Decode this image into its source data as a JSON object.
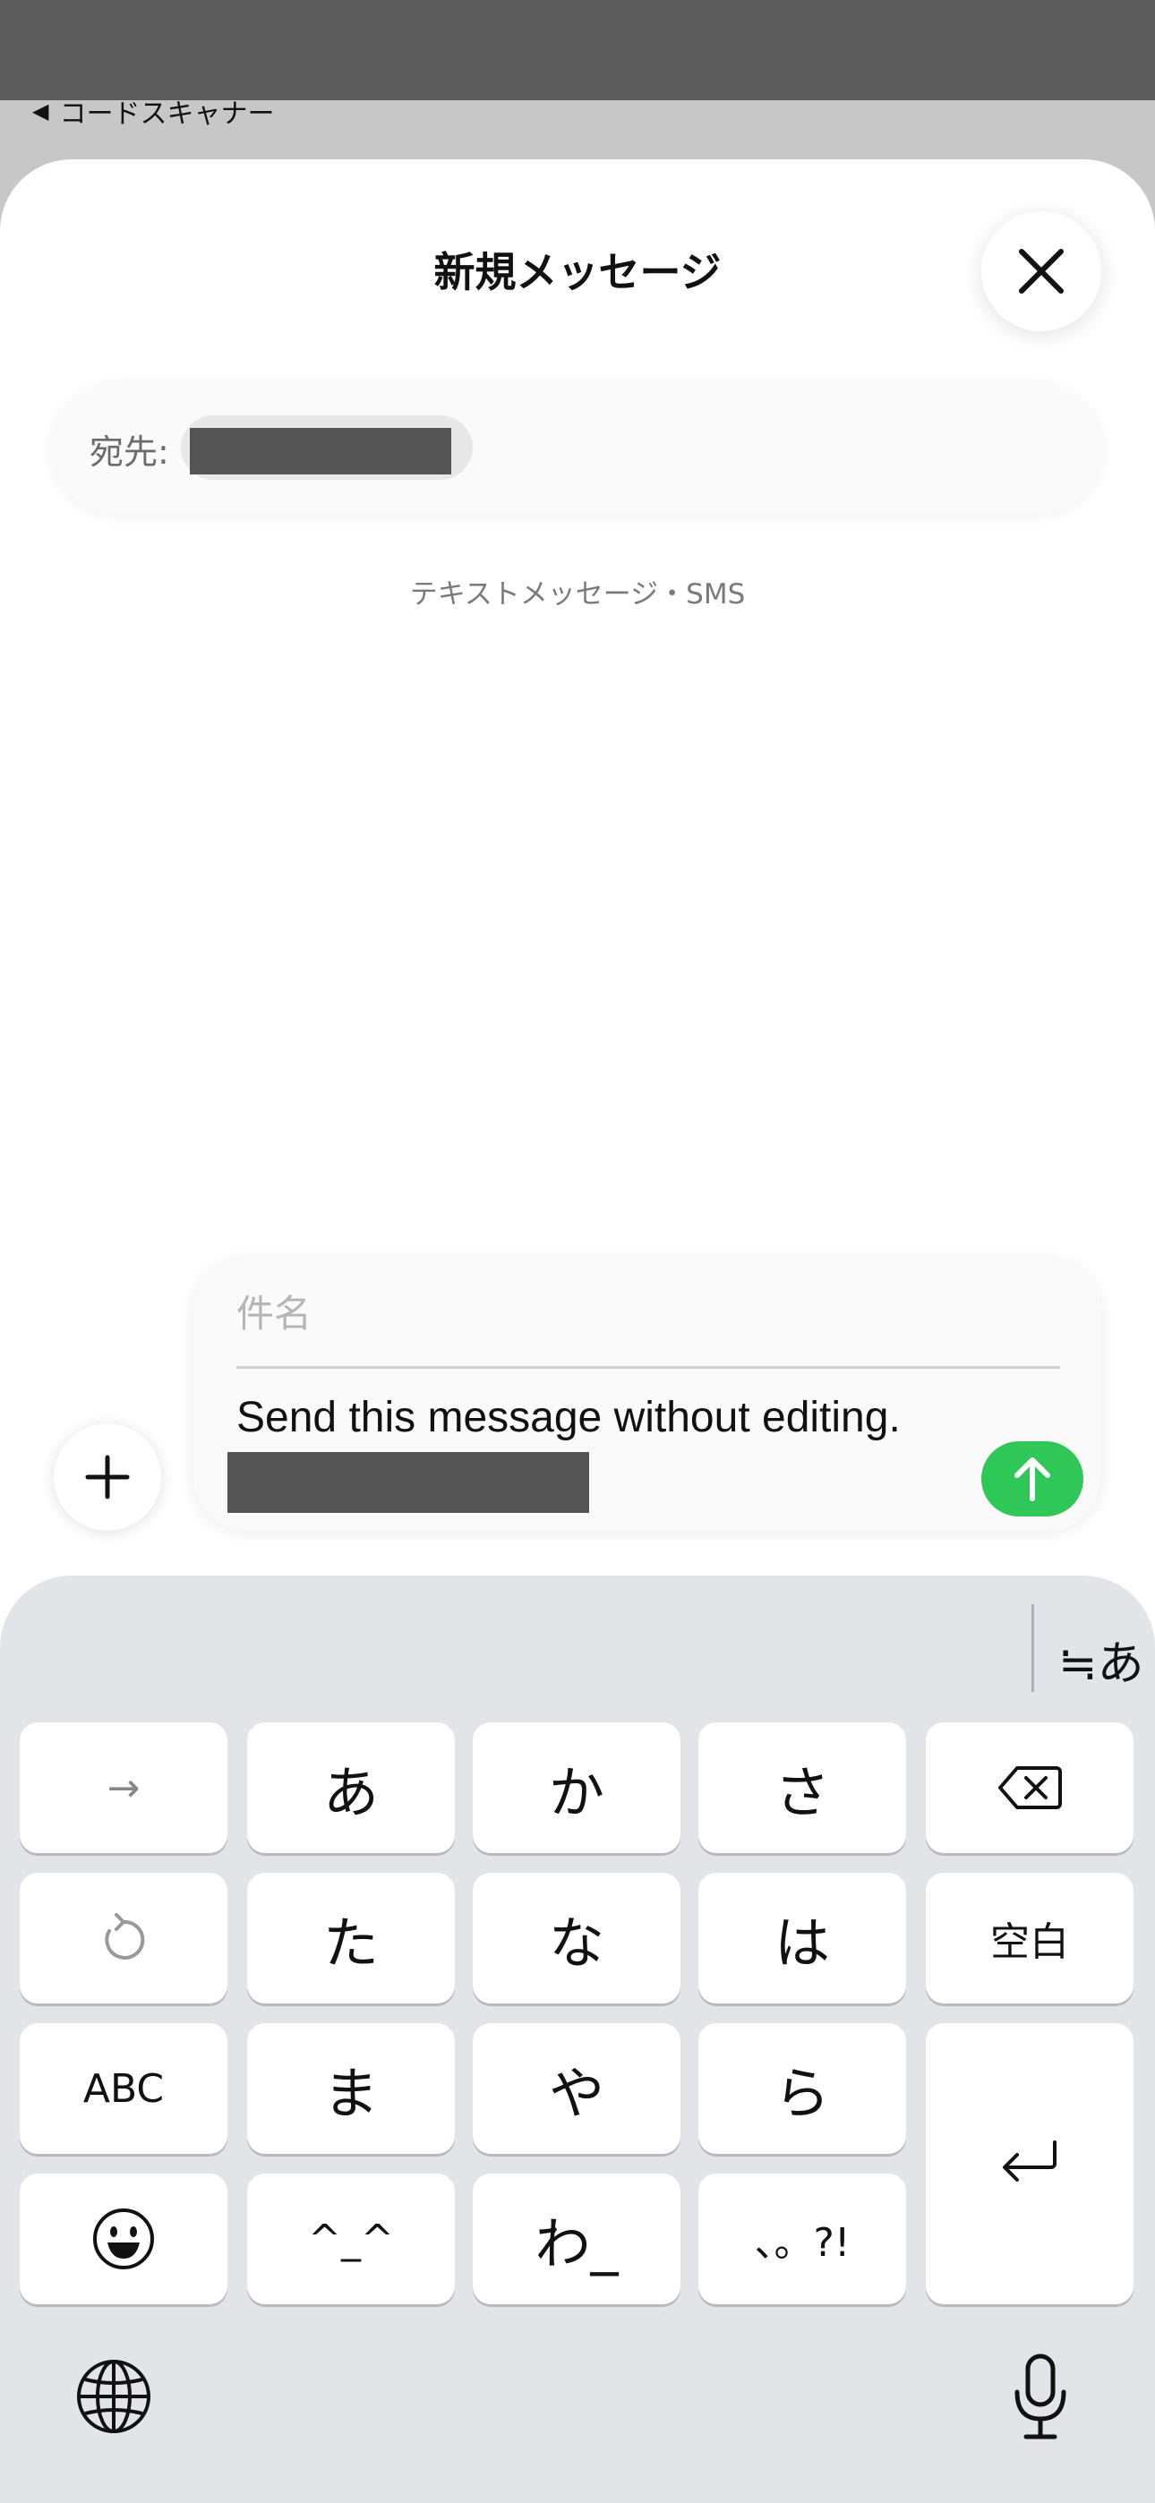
{
  "back_link": {
    "arrow": "◀",
    "label": "コードスキャナー"
  },
  "sheet": {
    "title": "新規メッセージ",
    "close_icon": "close-icon"
  },
  "recipient": {
    "label": "宛先:",
    "value": ""
  },
  "service_label": "テキストメッセージ・SMS",
  "compose": {
    "subject_placeholder": "件名",
    "message_text": "Send this message without editing.",
    "send_color": "#30c759"
  },
  "keyboard": {
    "mode_switch": "≒あ",
    "keys": {
      "arrow": "→",
      "a": "あ",
      "ka": "か",
      "sa": "さ",
      "ta": "た",
      "na": "な",
      "ha": "は",
      "space": "空白",
      "abc": "ABC",
      "ma": "ま",
      "ya": "や",
      "ra": "ら",
      "emoticon": "^_^",
      "wa": "わ_",
      "punct": "、。?!"
    }
  }
}
